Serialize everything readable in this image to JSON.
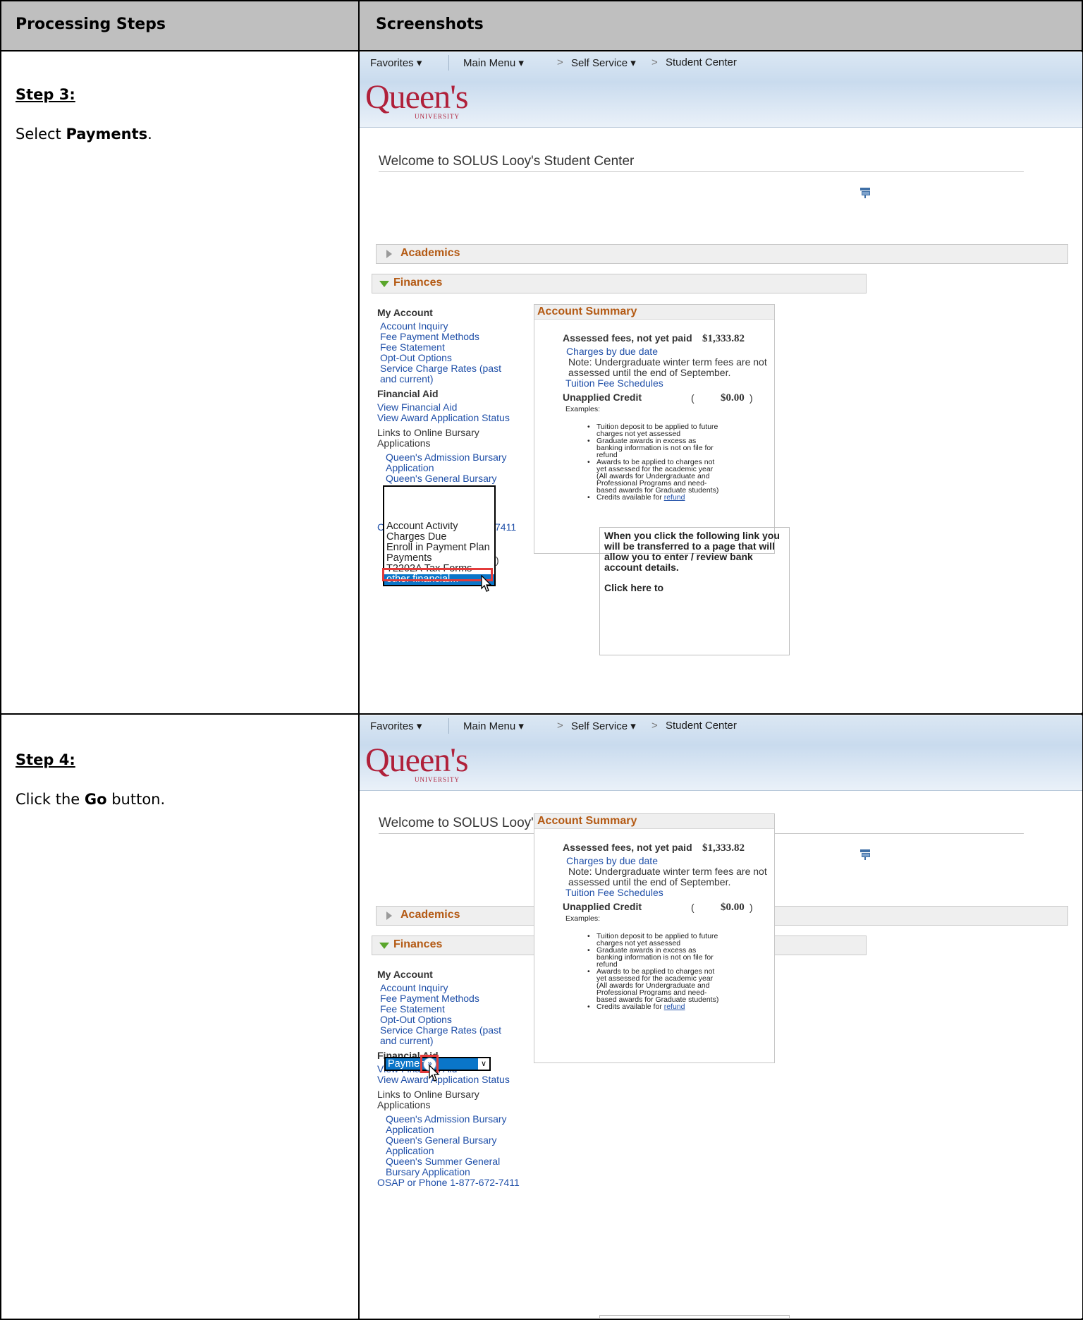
{
  "table": {
    "col_steps_header": "Processing Steps",
    "col_screens_header": "Screenshots"
  },
  "steps": [
    {
      "title": "Step 3:",
      "text_prefix": "Select ",
      "text_bold": "Payments",
      "text_suffix": "."
    },
    {
      "title": "Step 4:",
      "text_prefix": "Click the ",
      "text_bold": "Go",
      "text_suffix": " button."
    }
  ],
  "app": {
    "nav": {
      "favorites": "Favorites ▾",
      "main_menu": "Main Menu ▾",
      "self_service": "Self Service ▾",
      "student_center": "Student Center",
      "sep": ">"
    },
    "logo": "Queen's",
    "logo_sub": "UNIVERSITY",
    "welcome": "Welcome to SOLUS Looy's Student Center",
    "academics": "Academics",
    "finances": "Finances",
    "my_account": {
      "heading": "My Account",
      "links": [
        "Account Inquiry",
        "Fee Payment Methods",
        "Fee Statement",
        "Opt-Out Options",
        "Service Charge Rates (past",
        "and current)"
      ]
    },
    "financial_aid": {
      "heading": "Financial Aid",
      "links": [
        "View Financial Aid",
        "View Award Application Status"
      ],
      "bursary_intro": [
        "Links to Online Bursary",
        "Applications"
      ],
      "bursary_links": [
        "Queen's Admission Bursary",
        "Application",
        "Queen's General Bursary",
        "Application",
        "Queen's Summer General",
        "Bursary Application"
      ],
      "osap": "OSAP or Phone 1-877-672-7411",
      "osap_partial_c": "C",
      "osap_partial_tail": "7411"
    },
    "account_summary": {
      "title": "Account Summary",
      "assessed_label": "Assessed fees, not yet paid",
      "assessed_amount": "$1,333.82",
      "charges_link": "Charges by due date",
      "note_line1": "Note: Undergraduate winter term fees are not",
      "note_line2": "assessed until the end of September.",
      "tuition_link": "Tuition Fee Schedules",
      "unapplied_label": "Unapplied Credit",
      "unapplied_open": "(",
      "unapplied_amount": "$0.00",
      "unapplied_close": ")",
      "examples": "Examples:",
      "bullets": [
        [
          "Tuition deposit to be applied to future",
          "charges not yet assessed"
        ],
        [
          "Graduate awards in excess as",
          "banking information is not on file for",
          "refund"
        ],
        [
          "Awards to be applied to charges not",
          "yet assessed for the academic year",
          "(All awards for Undergraduate and",
          "Professional Programs and need-",
          "based awards for Graduate students)"
        ]
      ],
      "credits_prefix": "Credits available for ",
      "credits_link": "refund"
    },
    "bank_box": {
      "lines": [
        "When you click the following link you",
        "will be transferred to a page that will",
        "allow you to enter / review bank",
        "account details."
      ],
      "click_here": "Click here to"
    },
    "dropdown_options": [
      "Account Activity",
      "Charges Due",
      "Enroll in Payment Plan",
      "Payments",
      "T2202A Tax Forms",
      "other financial..."
    ],
    "dropdown_selected": "Payments",
    "select_value": "Payments",
    "select_arrow": "∨",
    "go_glyph": "»",
    "partial_paren": ")"
  },
  "colors": {
    "accent_orange": "#b45a14",
    "link_blue": "#1f4fa8",
    "highlight_red": "#e33b3b",
    "select_blue": "#0a76c9",
    "brand_red": "#b0203a"
  }
}
